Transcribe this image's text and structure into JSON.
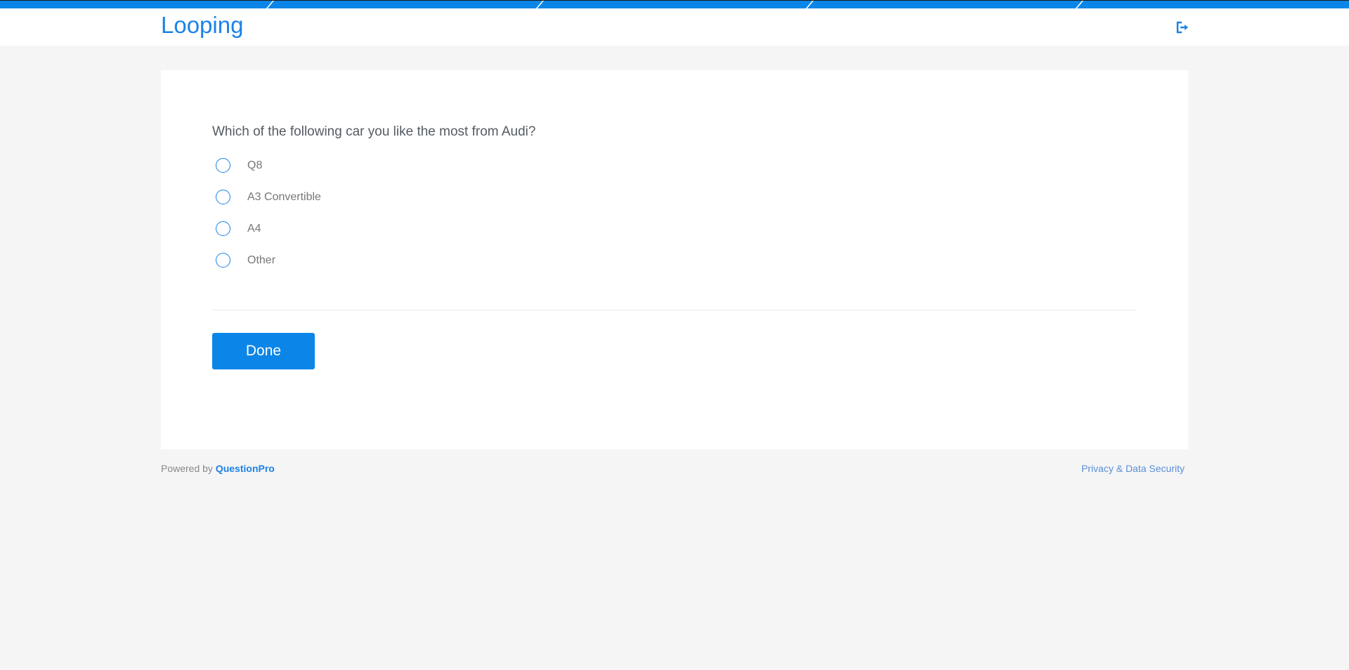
{
  "header": {
    "title": "Looping",
    "exit_icon": "exit-icon"
  },
  "survey": {
    "question": "Which of the following car you like the most from Audi?",
    "options": [
      {
        "label": "Q8"
      },
      {
        "label": "A3 Convertible"
      },
      {
        "label": "A4"
      },
      {
        "label": "Other"
      }
    ],
    "done_label": "Done"
  },
  "footer": {
    "powered_by": "Powered by",
    "brand": "QuestionPro",
    "privacy": "Privacy & Data Security"
  },
  "colors": {
    "accent": "#0b86e8"
  }
}
